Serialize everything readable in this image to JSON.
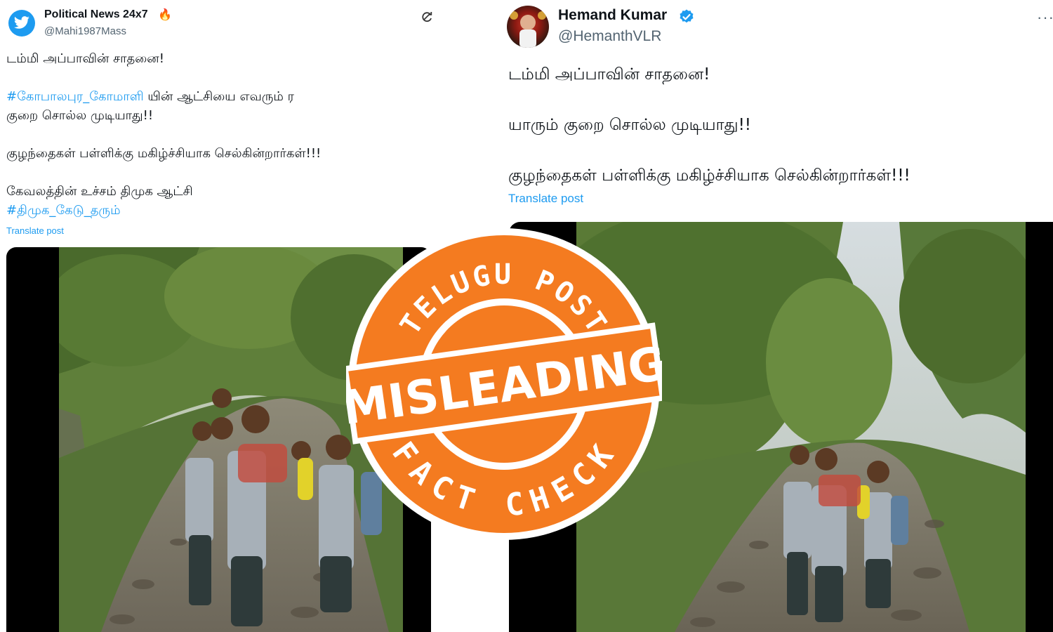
{
  "left_tweet": {
    "display_name": "Political News 24x7",
    "name_emoji": "🔥",
    "handle": "@Mahi1987Mass",
    "line1": "டம்மி அப்பாவின் சாதனை!",
    "hashtag1": "#கோபாலபுர_கோமாளி",
    "line2_rest": " யின் ஆட்சியை எவரும் ர",
    "line3": " குறை சொல்ல முடியாது!!",
    "line4": "குழந்தைகள் பள்ளிக்கு மகிழ்ச்சியாக செல்கின்றார்கள்!!!",
    "line5": "கேவலத்தின் உச்சம் திமுக ஆட்சி",
    "hashtag2": "#திமுக_கேடு_தரும்",
    "translate_label": "Translate post",
    "icons": {
      "avatar": "twitter-bird-icon",
      "action": "repost-icon"
    },
    "colors": {
      "link": "#1d9bf0",
      "avatar_bg": "#1d9bf0"
    }
  },
  "right_tweet": {
    "display_name": "Hemand Kumar",
    "handle": "@HemanthVLR",
    "line1": "டம்மி அப்பாவின் சாதனை!",
    "line2": "யாரும் குறை சொல்ல முடியாது!!",
    "line3": "குழந்தைகள் பள்ளிக்கு மகிழ்ச்சியாக செல்கின்றார்கள்!!!",
    "translate_label": "Translate post",
    "icons": {
      "verified": "verified-badge-icon",
      "more": "more-options-icon"
    },
    "colors": {
      "link": "#1d9bf0",
      "verified": "#1d9bf0"
    }
  },
  "stamp": {
    "top_text": "TELUGU POST",
    "center_text": "MISLEADING",
    "bottom_text": "FACT CHECK",
    "colors": {
      "orange": "#f47b20",
      "white": "#ffffff"
    }
  }
}
